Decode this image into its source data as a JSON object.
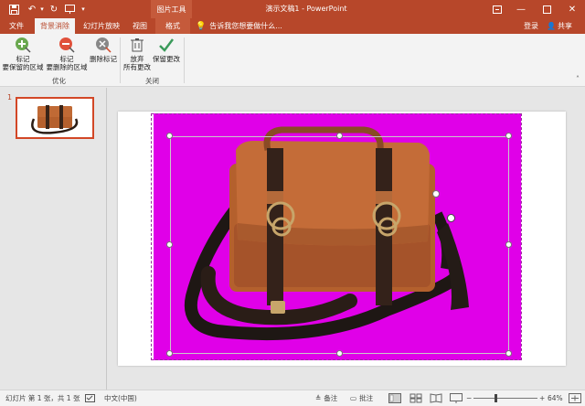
{
  "titlebar": {
    "doc_title": "演示文稿1 - PowerPoint",
    "context_group": "图片工具",
    "signin": "登录",
    "share": "共享"
  },
  "tabs": [
    {
      "label": "文件"
    },
    {
      "label": "背景消除"
    },
    {
      "label": "幻灯片放映"
    },
    {
      "label": "视图"
    },
    {
      "label": "格式"
    }
  ],
  "tellme": "告诉我您想要做什么...",
  "ribbon": {
    "mark_keep": [
      "标记",
      "要保留的区域"
    ],
    "mark_remove": [
      "标记",
      "要删除的区域"
    ],
    "delete_mark": "删除标记",
    "discard": [
      "放弃",
      "所有更改"
    ],
    "keep_changes": "保留更改",
    "group_refine": "优化",
    "group_close": "关闭"
  },
  "thumbs": {
    "slide_number": "1"
  },
  "statusbar": {
    "slide_info": "幻灯片 第 1 张，共 1 张",
    "language": "中文(中国)",
    "notes": "备注",
    "comments": "批注",
    "zoom": "64%"
  },
  "colors": {
    "brand": "#b7472a",
    "removal": "#e000e8"
  }
}
